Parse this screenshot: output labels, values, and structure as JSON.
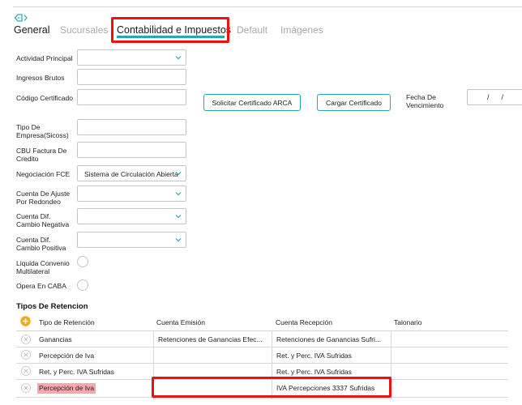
{
  "tabs": [
    {
      "label": "General",
      "active": false
    },
    {
      "label": "Sucursales",
      "active": false
    },
    {
      "label": "Contabilidad e Impuestos",
      "active": true
    },
    {
      "label": "Default",
      "active": false
    },
    {
      "label": "Imágenes",
      "active": false
    }
  ],
  "form": {
    "actividad_principal": {
      "label": "Actividad Principal",
      "value": ""
    },
    "ingresos_brutos": {
      "label": "Ingresos Brutos",
      "value": ""
    },
    "codigo_certificado": {
      "label": "Código Certificado",
      "value": ""
    },
    "tipo_empresa": {
      "label_1": "Tipo De",
      "label_2": "Empresa(Sicoss)",
      "value": ""
    },
    "cbu_factura": {
      "label_1": "CBU Factura De",
      "label_2": "Credito",
      "value": ""
    },
    "negociacion_fce": {
      "label": "Negociación FCE",
      "value": "Sistema de Circulación Abierta"
    },
    "cuenta_ajuste": {
      "label_1": "Cuenta De Ajuste",
      "label_2": "Por Redondeo",
      "value": ""
    },
    "cuenta_dif_negativa": {
      "label_1": "Cuenta Dif.",
      "label_2": "Cambio Negativa",
      "value": ""
    },
    "cuenta_dif_positiva": {
      "label_1": "Cuenta Dif.",
      "label_2": "Cambio Positiva",
      "value": ""
    },
    "liquida_convenio": {
      "label_1": "Liquida Convenio",
      "label_2": "Multilateral"
    },
    "opera_caba": {
      "label": "Opera En CABA"
    },
    "fecha_vencimiento": {
      "label_1": "Fecha De",
      "label_2": "Vencimiento",
      "value": "/    /"
    }
  },
  "buttons": {
    "solicitar_label": "Solicitar Certificado ARCA",
    "cargar_label": "Cargar Certificado"
  },
  "retenciones": {
    "title": "Tipos De Retencion",
    "columns": [
      "Tipo de Retención",
      "Cuenta Emisión",
      "Cuenta Recepción",
      "Talonario"
    ],
    "rows": [
      {
        "tipo": "Ganancias",
        "emision": "Retenciones de Ganancias Efec...",
        "recepcion": "Retenciones de Ganancias Sufri...",
        "talonario": ""
      },
      {
        "tipo": "Percepción de Iva",
        "emision": "",
        "recepcion": "Ret. y Perc. IVA Sufridas",
        "talonario": ""
      },
      {
        "tipo": "Ret. y Perc. IVA Sufridas",
        "emision": "",
        "recepcion": "Ret. y Perc. IVA Sufridas",
        "talonario": ""
      },
      {
        "tipo": "Percepción de Iva",
        "emision": "",
        "recepcion": "IVA Percepciones 3337 Sufridas",
        "talonario": ""
      }
    ]
  },
  "colors": {
    "accent": "#2aa7b5",
    "highlight": "#ee1111",
    "row_error": "#f6a8ad",
    "add": "#f5a623"
  }
}
